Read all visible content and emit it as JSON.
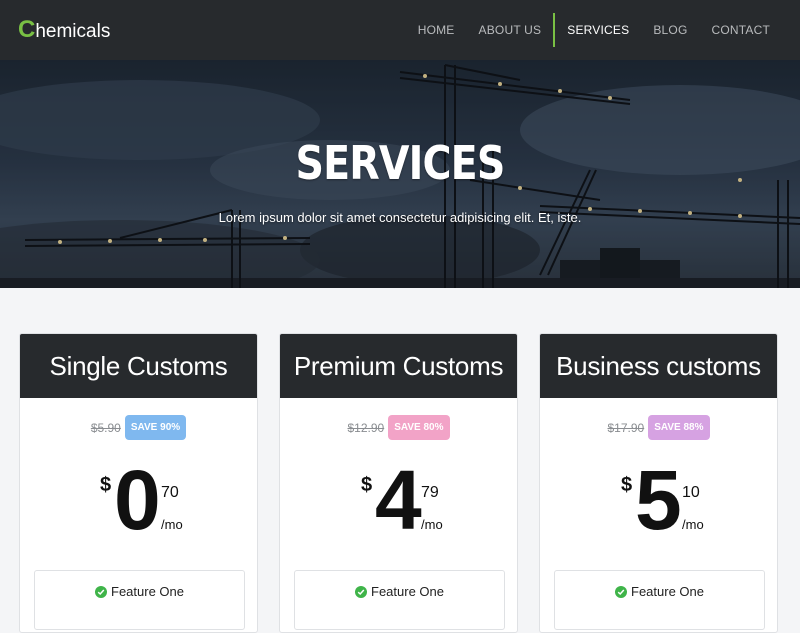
{
  "brand": {
    "first_letter": "C",
    "rest": "hemicals"
  },
  "nav": {
    "items": [
      {
        "label": "HOME",
        "active": false
      },
      {
        "label": "ABOUT US",
        "active": false
      },
      {
        "label": "SERVICES",
        "active": true
      },
      {
        "label": "BLOG",
        "active": false
      },
      {
        "label": "CONTACT",
        "active": false
      }
    ]
  },
  "hero": {
    "title": "SERVICES",
    "subtitle": "Lorem ipsum dolor sit amet consectetur adipisicing elit. Et, iste."
  },
  "colors": {
    "accent": "#79c044",
    "navbar_bg": "#272a2d",
    "check_green": "#3fb449"
  },
  "plans": [
    {
      "name": "Single Customs",
      "old_price": "$5.90",
      "save_label": "SAVE 90%",
      "save_color": "#7fb8ef",
      "currency": "$",
      "amount": "0",
      "cents": "70",
      "period": "/mo",
      "feature": "Feature One"
    },
    {
      "name": "Premium Customs",
      "old_price": "$12.90",
      "save_label": "SAVE 80%",
      "save_color": "#f2a3c7",
      "currency": "$",
      "amount": "4",
      "cents": "79",
      "period": "/mo",
      "feature": "Feature One"
    },
    {
      "name": "Business customs",
      "old_price": "$17.90",
      "save_label": "SAVE 88%",
      "save_color": "#d6a2e2",
      "currency": "$",
      "amount": "5",
      "cents": "10",
      "period": "/mo",
      "feature": "Feature One"
    }
  ],
  "icons": {
    "feature_check": "check-circle-icon"
  }
}
